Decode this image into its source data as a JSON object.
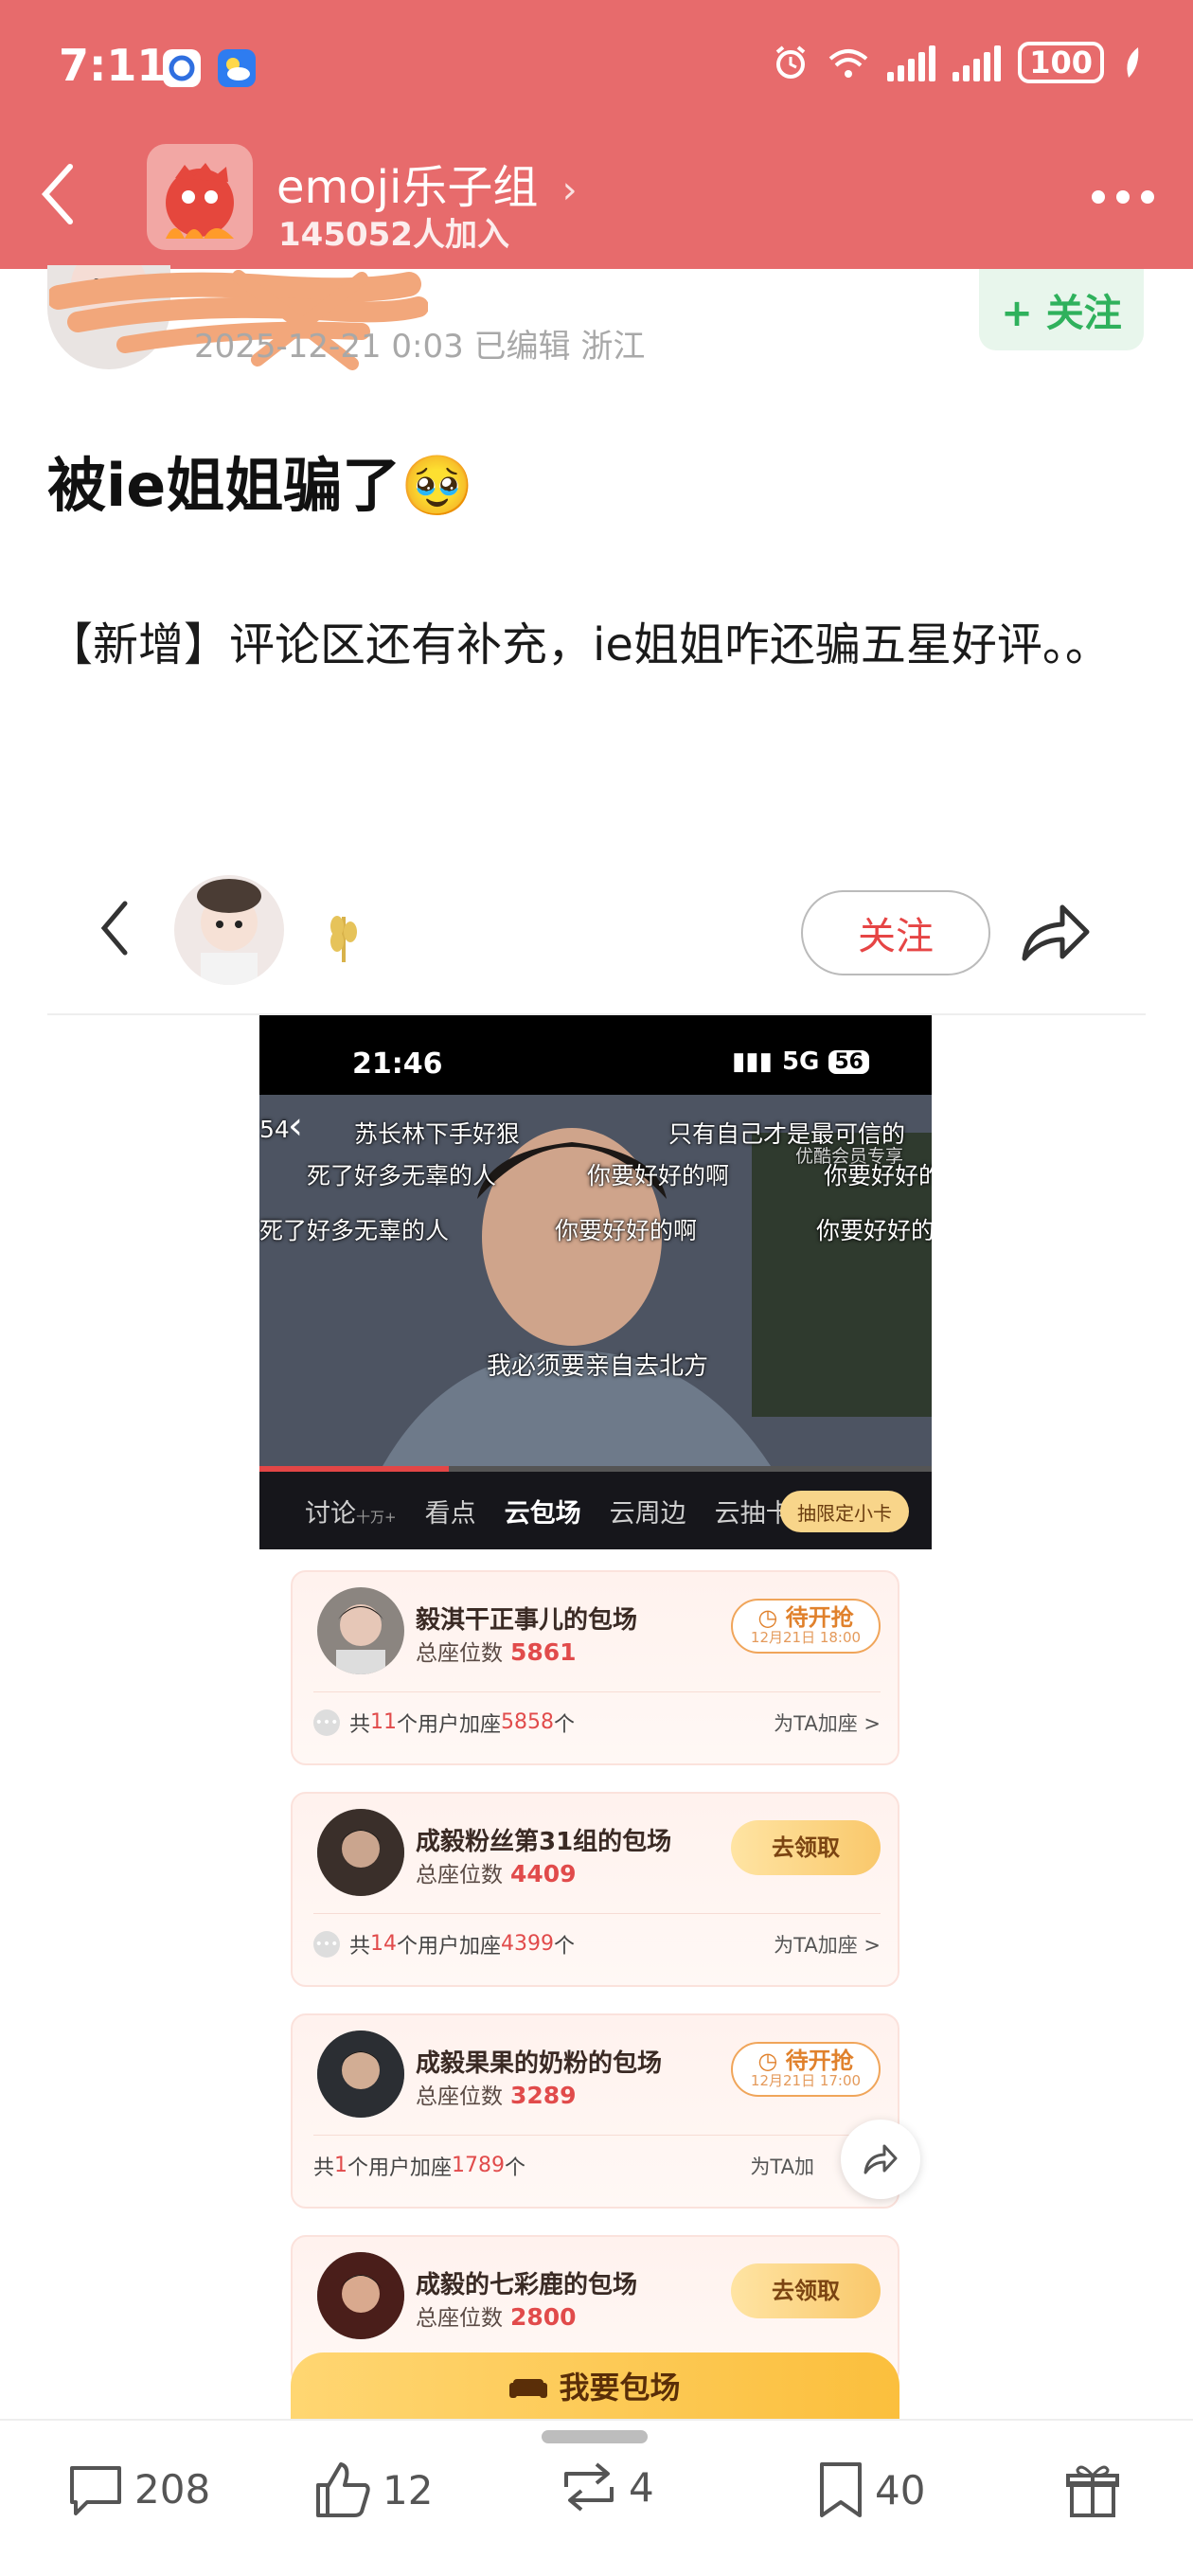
{
  "status_bar": {
    "time": "7:11",
    "battery": "100"
  },
  "header": {
    "group_name": "emoji乐子组",
    "member_count": "145052人加入"
  },
  "post": {
    "meta": "2025-12-21 0:03  已编辑  浙江",
    "follow_label": "+ 关注",
    "title": "被ie姐姐骗了🥹",
    "body": "【新增】评论区还有补充，ie姐姐咋还骗五星好评。。"
  },
  "embed": {
    "follow_label": "关注"
  },
  "screenshot": {
    "time": "21:46",
    "network": "5G",
    "battery": "56",
    "danmaku": [
      "54",
      "苏长林下手好狠",
      "只有自己才是最可信的",
      "优酷会员专享",
      "死了好多无辜的人",
      "你要好好的啊",
      "你要好好的",
      "死了好多无辜的人",
      "你要好好的啊",
      "你要好好的",
      "我必须要亲自去北方"
    ],
    "tabs": [
      {
        "label": "讨论",
        "sub": "十万+"
      },
      {
        "label": "看点",
        "sub": ""
      },
      {
        "label": "云包场",
        "sub": ""
      },
      {
        "label": "云周边",
        "sub": ""
      },
      {
        "label": "云抽卡",
        "sub": ""
      }
    ],
    "card_button": "抽限定小卡"
  },
  "cards": [
    {
      "name": "毅淇干正事儿的包场",
      "seat_label": "总座位数",
      "seats": "5861",
      "button": "待开抢",
      "button_date": "12月21日 18:00",
      "foot_pre": "共",
      "users": "11",
      "foot_mid": "个用户加座",
      "added": "5858",
      "foot_post": "个",
      "help": "为TA加座 >"
    },
    {
      "name": "成毅粉丝第31组的包场",
      "seat_label": "总座位数",
      "seats": "4409",
      "button": "去领取",
      "button_date": "",
      "foot_pre": "共",
      "users": "14",
      "foot_mid": "个用户加座",
      "added": "4399",
      "foot_post": "个",
      "help": "为TA加座 >"
    },
    {
      "name": "成毅果果的奶粉的包场",
      "seat_label": "总座位数",
      "seats": "3289",
      "button": "待开抢",
      "button_date": "12月21日 17:00",
      "foot_pre": "共",
      "users": "1",
      "foot_mid": "个用户加座",
      "added": "1789",
      "foot_post": "个",
      "help": "为TA加"
    },
    {
      "name": "成毅的七彩鹿的包场",
      "seat_label": "总座位数",
      "seats": "2800",
      "button": "去领取",
      "button_date": ""
    }
  ],
  "big_button": "我要包场",
  "actions": {
    "comments": "208",
    "likes": "12",
    "reposts": "4",
    "bookmarks": "40"
  },
  "colors": {
    "header_bg": "#e76b6c",
    "follow_green": "#2fb15c",
    "accent_red": "#e14b4b"
  }
}
